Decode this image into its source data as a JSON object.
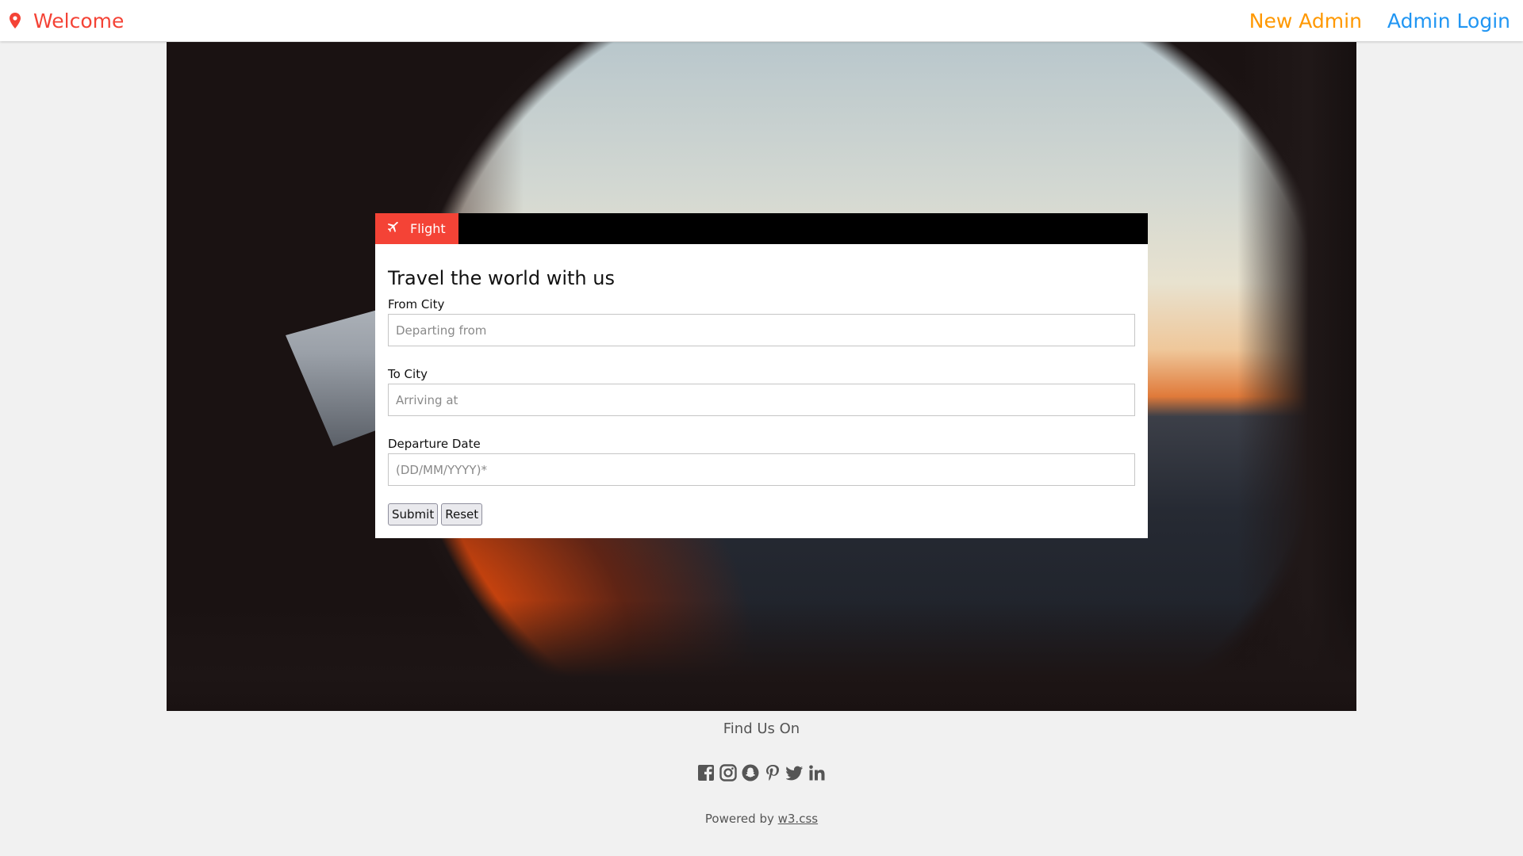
{
  "nav": {
    "brand_label": "Welcome",
    "brand_icon": "map-marker-icon",
    "new_admin_label": "New Admin",
    "admin_login_label": "Admin Login"
  },
  "colors": {
    "brand": "#f44336",
    "new_admin": "#ff9800",
    "admin_login": "#2196f3",
    "tabbar": "#000000"
  },
  "booking": {
    "tab_label": "Flight",
    "tab_icon": "plane-icon",
    "title": "Travel the world with us",
    "from_label": "From City",
    "from_placeholder": "Departing from",
    "to_label": "To City",
    "to_placeholder": "Arriving at",
    "date_label": "Departure Date",
    "date_placeholder": "(DD/MM/YYYY)*",
    "submit_label": "Submit",
    "reset_label": "Reset"
  },
  "footer": {
    "find_us": "Find Us On",
    "social_icons": [
      "facebook-icon",
      "instagram-icon",
      "snapchat-icon",
      "pinterest-icon",
      "twitter-icon",
      "linkedin-icon"
    ],
    "powered_prefix": "Powered by ",
    "powered_link": "w3.css"
  }
}
